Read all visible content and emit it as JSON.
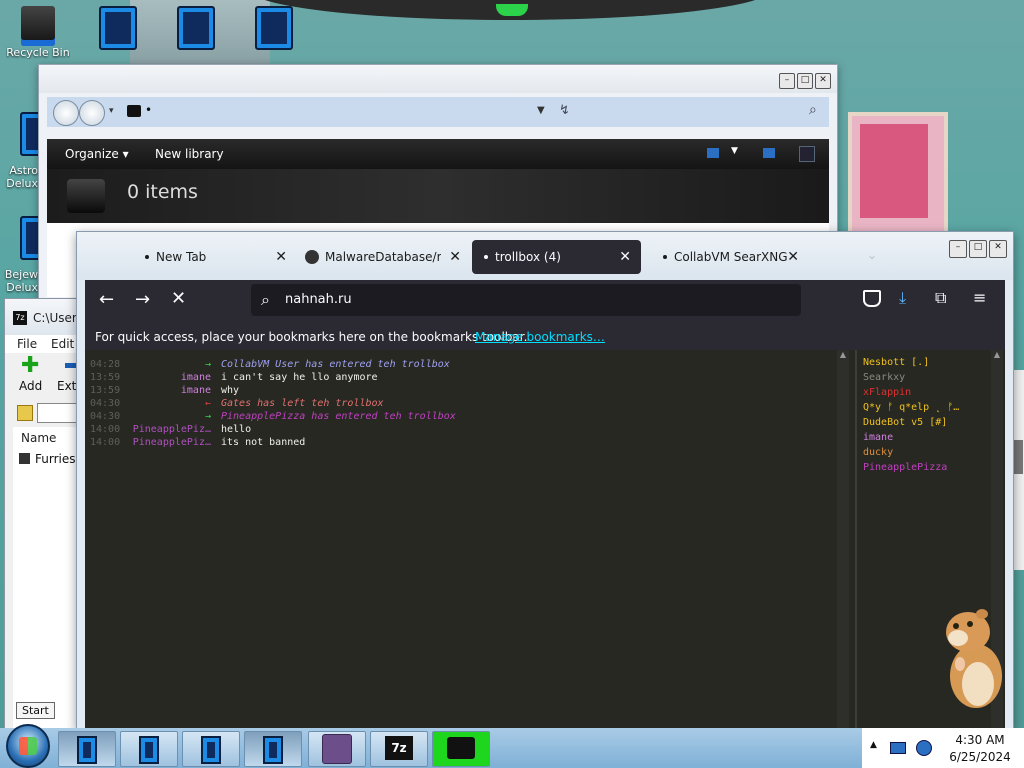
{
  "desktop": {
    "icons": [
      {
        "label": "Recycle Bin"
      },
      {
        "label": ""
      },
      {
        "label": "Astro Delux"
      },
      {
        "label": "Bejew Delux"
      }
    ]
  },
  "explorer": {
    "address_text": "•",
    "toolbar": {
      "organize": "Organize",
      "new_library": "New library"
    },
    "header_count": "0 items"
  },
  "zip": {
    "title": "C:\\Users",
    "menu": [
      "File",
      "Edit"
    ],
    "add_label": "Add",
    "extract_label": "Extr",
    "column_name": "Name",
    "file_row": "Furries."
  },
  "firefox": {
    "tabs": [
      {
        "label": "New Tab",
        "active": false
      },
      {
        "label": "MalwareDatabase/ran",
        "active": false
      },
      {
        "label": "trollbox (4)",
        "active": true
      },
      {
        "label": "CollabVM SearXNG",
        "active": false
      }
    ],
    "url": "nahnah.ru",
    "bookmarks_text": "For quick access, place your bookmarks here on the bookmarks toolbar.",
    "bookmarks_link": "Manage bookmarks…"
  },
  "trollbox": {
    "messages": [
      {
        "time": "04:28",
        "nick": "→",
        "nick_color": "#39d353",
        "text": "CollabVM User has entered teh trollbox",
        "text_color": "#9fa0f0",
        "italic": true
      },
      {
        "time": "13:59",
        "nick": "imane",
        "nick_color": "#d080e0",
        "text": "i can't say he llo anymore",
        "text_color": "#f0f0e8",
        "italic": false
      },
      {
        "time": "13:59",
        "nick": "imane",
        "nick_color": "#d080e0",
        "text": "why",
        "text_color": "#f0f0e8",
        "italic": false
      },
      {
        "time": "04:30",
        "nick": "←",
        "nick_color": "#e04040",
        "text": "Gates has left teh trollbox",
        "text_color": "#e07070",
        "italic": true
      },
      {
        "time": "04:30",
        "nick": "→",
        "nick_color": "#39d353",
        "text": "PineapplePizza has entered teh trollbox",
        "text_color": "#c040c0",
        "italic": true
      },
      {
        "time": "14:00",
        "nick": "PineapplePiz…",
        "nick_color": "#b050c0",
        "text": "hello",
        "text_color": "#f0f0e8",
        "italic": false
      },
      {
        "time": "14:00",
        "nick": "PineapplePiz…",
        "nick_color": "#b050c0",
        "text": "its not banned",
        "text_color": "#f0f0e8",
        "italic": false
      }
    ],
    "users": [
      {
        "name": "Nesbott [.]",
        "color": "#f0c020"
      },
      {
        "name": "Searkxy",
        "color": "#8a8a80"
      },
      {
        "name": "xFlappin",
        "color": "#e03030"
      },
      {
        "name": "Q*y ᚠ q*elp ˛ ᚠ…",
        "color": "#f0c020"
      },
      {
        "name": "DudeBot v5 [#]",
        "color": "#f0c020"
      },
      {
        "name": "imane",
        "color": "#d080e0"
      },
      {
        "name": "ducky",
        "color": "#e09040"
      },
      {
        "name": "PineapplePizza",
        "color": "#c040c0"
      }
    ]
  },
  "taskbar": {
    "start_tooltip": "Start",
    "clock_time": "4:30 AM",
    "clock_date": "6/25/2024"
  }
}
